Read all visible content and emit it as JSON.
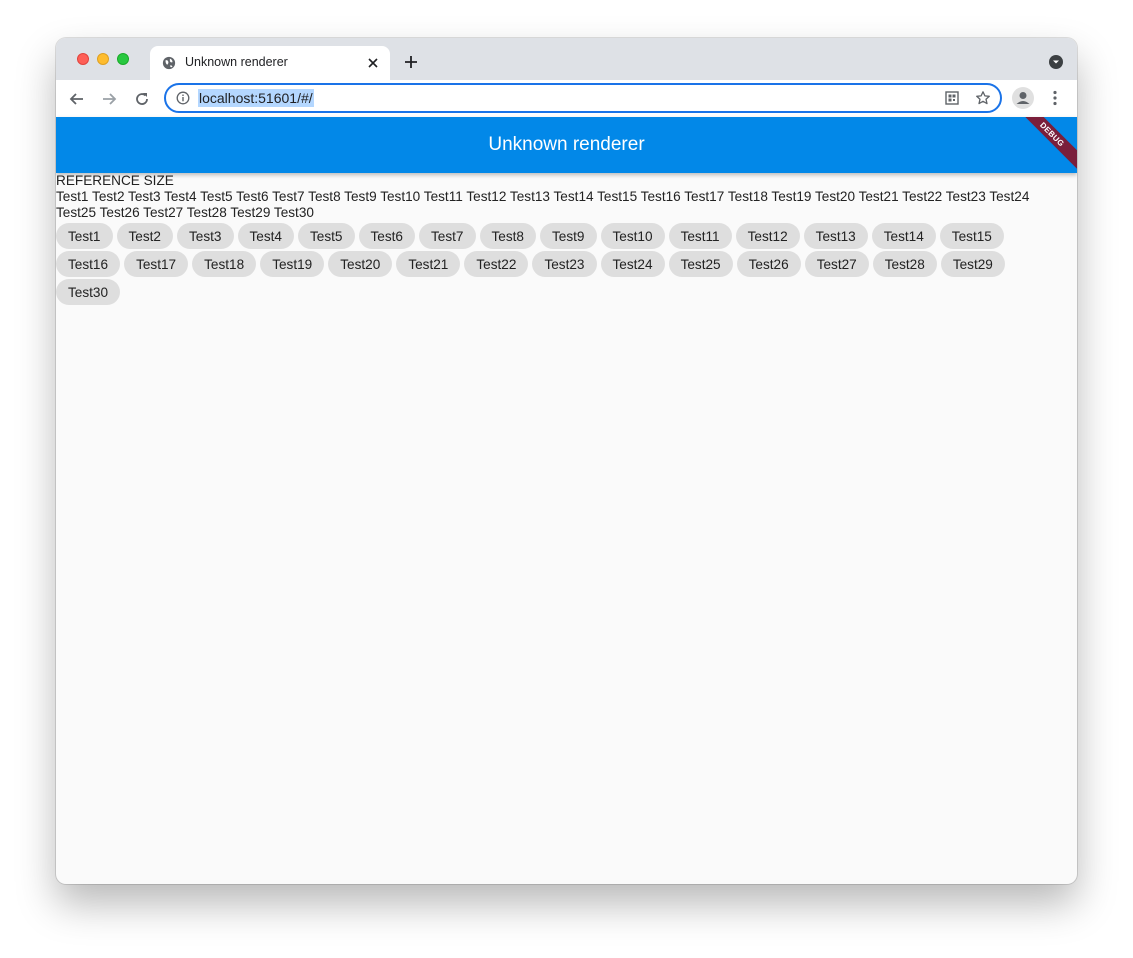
{
  "browser": {
    "tab_title": "Unknown renderer",
    "url": "localhost:51601/#/"
  },
  "app": {
    "title": "Unknown renderer",
    "debug_label": "DEBUG",
    "primary_color": "#0288e8"
  },
  "reference": {
    "heading": "REFERENCE SIZE",
    "text": "Test1 Test2 Test3 Test4 Test5 Test6 Test7 Test8 Test9 Test10 Test11 Test12 Test13 Test14 Test15 Test16 Test17 Test18 Test19 Test20 Test21 Test22 Test23 Test24 Test25 Test26 Test27 Test28 Test29 Test30"
  },
  "chips": [
    "Test1",
    "Test2",
    "Test3",
    "Test4",
    "Test5",
    "Test6",
    "Test7",
    "Test8",
    "Test9",
    "Test10",
    "Test11",
    "Test12",
    "Test13",
    "Test14",
    "Test15",
    "Test16",
    "Test17",
    "Test18",
    "Test19",
    "Test20",
    "Test21",
    "Test22",
    "Test23",
    "Test24",
    "Test25",
    "Test26",
    "Test27",
    "Test28",
    "Test29",
    "Test30"
  ]
}
